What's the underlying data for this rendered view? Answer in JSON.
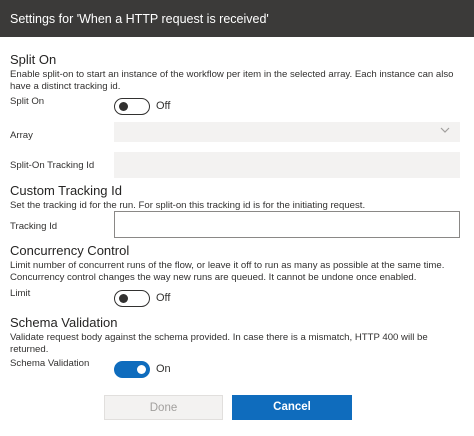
{
  "dialog": {
    "title": "Settings for 'When a HTTP request is received'"
  },
  "split_on": {
    "heading": "Split On",
    "description": "Enable split-on to start an instance of the workflow per item in the selected array. Each instance can also have a distinct tracking id.",
    "toggle_label": "Split On",
    "toggle_state": "Off",
    "array_label": "Array",
    "array_value": "",
    "tracking_label": "Split-On Tracking Id",
    "tracking_value": ""
  },
  "custom_tracking": {
    "heading": "Custom Tracking Id",
    "description": "Set the tracking id for the run. For split-on this tracking id is for the initiating request.",
    "field_label": "Tracking Id",
    "field_value": ""
  },
  "concurrency": {
    "heading": "Concurrency Control",
    "description": "Limit number of concurrent runs of the flow, or leave it off to run as many as possible at the same time. Concurrency control changes the way new runs are queued. It cannot be undone once enabled.",
    "toggle_label": "Limit",
    "toggle_state": "Off"
  },
  "schema": {
    "heading": "Schema Validation",
    "description": "Validate request body against the schema provided. In case there is a mismatch, HTTP 400 will be returned.",
    "toggle_label": "Schema Validation",
    "toggle_state": "On"
  },
  "footer": {
    "done_label": "Done",
    "cancel_label": "Cancel"
  },
  "colors": {
    "accent": "#0f6cbd",
    "titlebar": "#3b3a39",
    "disabled_field": "#f3f2f1"
  },
  "icons": {
    "array_dropdown": "chevron-down-icon"
  }
}
